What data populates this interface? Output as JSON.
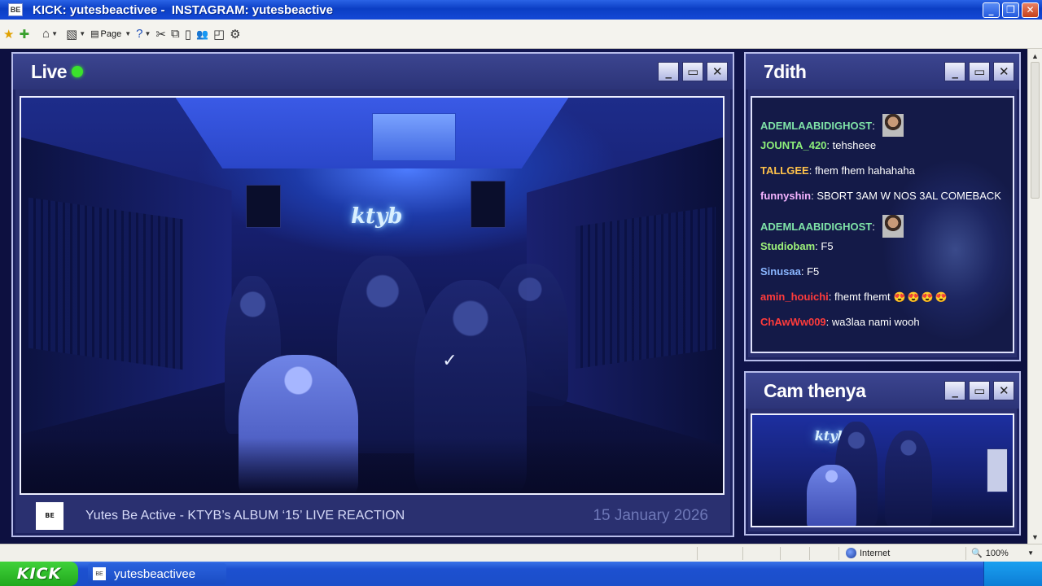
{
  "window": {
    "title": "KICK: yutesbeactivee -  INSTAGRAM: yutesbeactive",
    "app_icon": "BE",
    "controls": {
      "minimize": "_",
      "maximize": "❐",
      "close": "✕"
    }
  },
  "toolbar": {
    "items": [
      {
        "icon": "star-icon",
        "glyph": "★"
      },
      {
        "icon": "add-favorite-icon",
        "glyph": "✚"
      },
      {
        "icon": "home-icon",
        "glyph": "⌂"
      },
      {
        "icon": "feeds-icon",
        "glyph": "▧"
      },
      {
        "icon": "page-icon",
        "glyph": "▤",
        "label": "Page"
      },
      {
        "icon": "help-icon",
        "glyph": "?"
      },
      {
        "icon": "tools-icon",
        "glyph": "✂"
      },
      {
        "icon": "copy-icon",
        "glyph": "⧉"
      },
      {
        "icon": "clipboard-icon",
        "glyph": "▯"
      },
      {
        "icon": "people-icon",
        "glyph": "👥"
      },
      {
        "icon": "window-icon",
        "glyph": "◰"
      },
      {
        "icon": "gear-icon",
        "glyph": "⚙"
      }
    ]
  },
  "live_panel": {
    "title": "Live",
    "live_color": "#3be22c",
    "stream_title": "Yutes Be Active - KTYB’s ALBUM ‘15’ LIVE REACTION",
    "date": "15 January 2026",
    "logo_text": "BE",
    "neon_sign": "ktyb"
  },
  "chat_panel": {
    "title": "7dith",
    "messages": [
      {
        "user": "ADEMLAABIDIGHOST",
        "text": "",
        "user_color": "#7fe3a8",
        "emote": true
      },
      {
        "user": "JOUNTA_420",
        "text": "tehsheee",
        "user_color": "#8df07a",
        "emote": false
      },
      {
        "user": "TALLGEE",
        "text": "fhem fhem hahahaha",
        "user_color": "#ffc24a",
        "emote": false
      },
      {
        "user": "funnyshin",
        "text": "SBORT 3AM W NOS 3AL COMEBACK",
        "user_color": "#f4b3ff",
        "emote": false
      },
      {
        "user": "ADEMLAABIDIGHOST",
        "text": "",
        "user_color": "#7fe3a8",
        "emote": true
      },
      {
        "user": "Studiobam",
        "text": "F5",
        "user_color": "#9ef27a",
        "emote": false
      },
      {
        "user": "Sinusaa",
        "text": "F5",
        "user_color": "#8ab6ff",
        "emote": false
      },
      {
        "user": "amin_houichi",
        "text": "fhemt fhemt",
        "user_color": "#ff3b3b",
        "emote": false,
        "hearts": "😍😍😍😍"
      },
      {
        "user": "ChAwWw009",
        "text": "wa3laa nami wooh",
        "user_color": "#ff3b3b",
        "emote": false
      }
    ]
  },
  "cam_panel": {
    "title": "Cam thenya",
    "neon_sign": "ktyb"
  },
  "statusbar": {
    "zone": "Internet",
    "zoom": "100%"
  },
  "taskbar": {
    "start_label": "KICK",
    "task_label": "yutesbeactivee",
    "task_icon": "BE"
  }
}
